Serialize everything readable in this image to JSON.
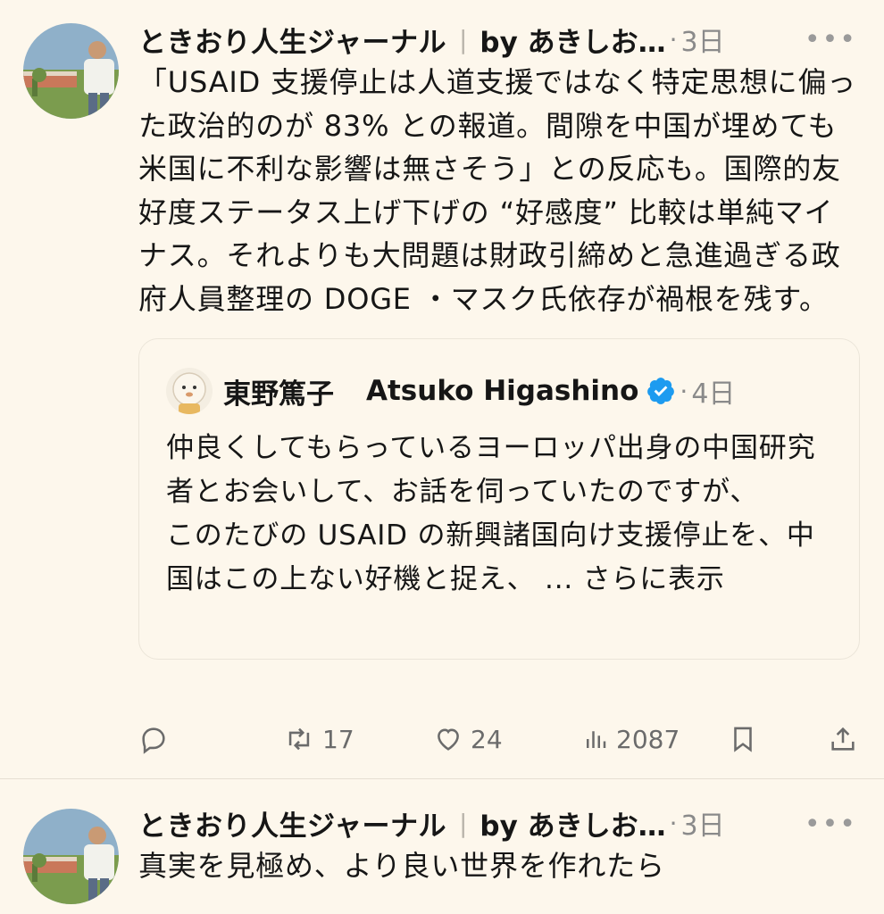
{
  "post1": {
    "author": "ときおり人生ジャーナル",
    "separator": "|",
    "handle": "by あきしお…",
    "dot": "·",
    "time": "3日",
    "more": "•••",
    "text": "「USAID 支援停止は人道支援ではなく特定思想に偏った政治的のが 83% との報道。間隙を中国が埋めても米国に不利な影響は無さそう」との反応も。国際的友好度ステータス上げ下げの “好感度” 比較は単純マイナス。それよりも大問題は財政引締めと急進過ぎる政府人員整理の DOGE ・マスク氏依存が禍根を残す。",
    "quote": {
      "name": "東野篤子",
      "name_latin": "Atsuko Higashino",
      "dot": "·",
      "time": "4日",
      "text": "仲良くしてもらっているヨーロッパ出身の中国研究者とお会いして、お話を伺っていたのですが、\nこのたびの USAID の新興諸国向け支援停止を、中国はこの上ない好機と捉え、 ... さらに表示"
    },
    "actions": {
      "reply_count": "",
      "retweet_count": "17",
      "like_count": "24",
      "views_count": "2087"
    }
  },
  "post2": {
    "author": "ときおり人生ジャーナル",
    "separator": "|",
    "handle": "by あきしお…",
    "dot": "·",
    "time": "3日",
    "more": "•••",
    "text": "真実を見極め、より良い世界を作れたら"
  },
  "icons": {
    "reply": "reply-icon",
    "retweet": "retweet-icon",
    "like": "heart-icon",
    "views": "views-icon",
    "bookmark": "bookmark-icon",
    "share": "share-icon",
    "verified": "verified-badge-icon"
  },
  "colors": {
    "background": "#fdf7ec",
    "verified": "#1d9bf0",
    "muted": "#8a8a8a"
  }
}
